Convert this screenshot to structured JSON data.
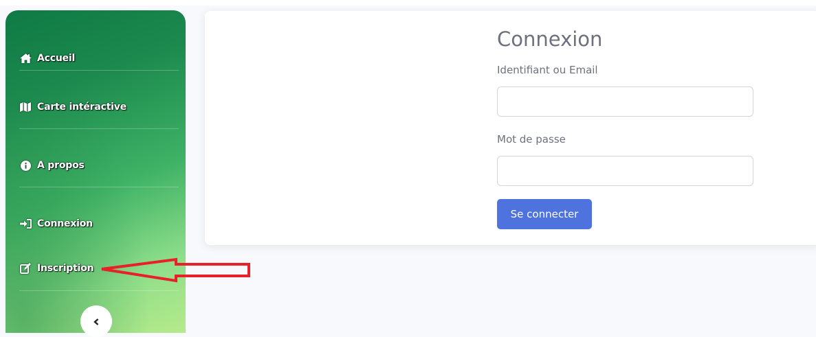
{
  "sidebar": {
    "items": [
      {
        "label": "Accueil",
        "icon": "home-icon"
      },
      {
        "label": "Carte intéractive",
        "icon": "map-icon"
      },
      {
        "label": "A propos",
        "icon": "info-icon"
      },
      {
        "label": "Connexion",
        "icon": "sign-in-icon"
      },
      {
        "label": "Inscription",
        "icon": "edit-icon"
      }
    ],
    "toggle_icon": "chevron-left-icon",
    "gradient_colors": [
      "#0f7a45",
      "#3fb266",
      "#b6ea8b"
    ]
  },
  "login": {
    "title": "Connexion",
    "username_label": "Identifiant ou Email",
    "username_value": "",
    "password_label": "Mot de passe",
    "password_value": "",
    "submit_label": "Se connecter"
  },
  "colors": {
    "primary": "#4e73df",
    "text_muted": "#6e707e",
    "annotation": "#e8202a"
  }
}
